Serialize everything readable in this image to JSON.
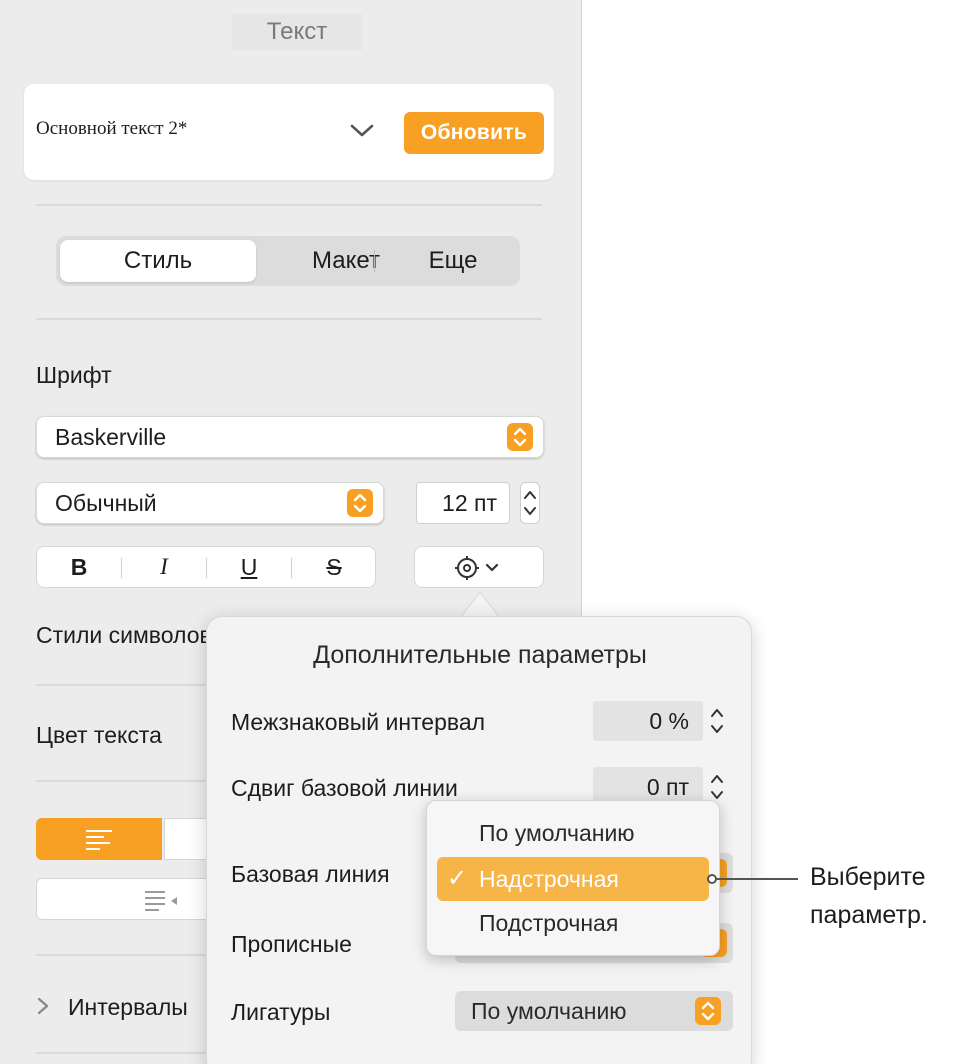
{
  "sidebar": {
    "title": "Текст",
    "paragraph_style": {
      "name": "Основной текст 2*",
      "update_label": "Обновить"
    },
    "tabs": [
      {
        "label": "Стиль",
        "active": true
      },
      {
        "label": "Макет",
        "active": false
      },
      {
        "label": "Еще",
        "active": false
      }
    ],
    "font": {
      "section_label": "Шрифт",
      "family": "Baskerville",
      "typeface": "Обычный",
      "size": "12 пт"
    },
    "format_buttons": [
      "B",
      "I",
      "U",
      "S"
    ],
    "char_styles_label": "Стили символов",
    "text_color_label": "Цвет текста",
    "spacing_label": "Интервалы",
    "accent_color": "#f7a024"
  },
  "popover": {
    "title": "Дополнительные параметры",
    "character_spacing": {
      "label": "Межзнаковый интервал",
      "value": "0 %"
    },
    "baseline_shift": {
      "label": "Сдвиг базовой линии",
      "value": "0 пт"
    },
    "baseline": {
      "label": "Базовая линия"
    },
    "capitalization": {
      "label": "Прописные"
    },
    "ligatures": {
      "label": "Лигатуры",
      "value": "По умолчанию"
    }
  },
  "baseline_menu": {
    "items": [
      {
        "label": "По умолчанию",
        "selected": false
      },
      {
        "label": "Надстрочная",
        "selected": true
      },
      {
        "label": "Подстрочная",
        "selected": false
      }
    ],
    "check_glyph": "✓"
  },
  "callout": {
    "line1": "Выберите",
    "line2": "параметр."
  }
}
